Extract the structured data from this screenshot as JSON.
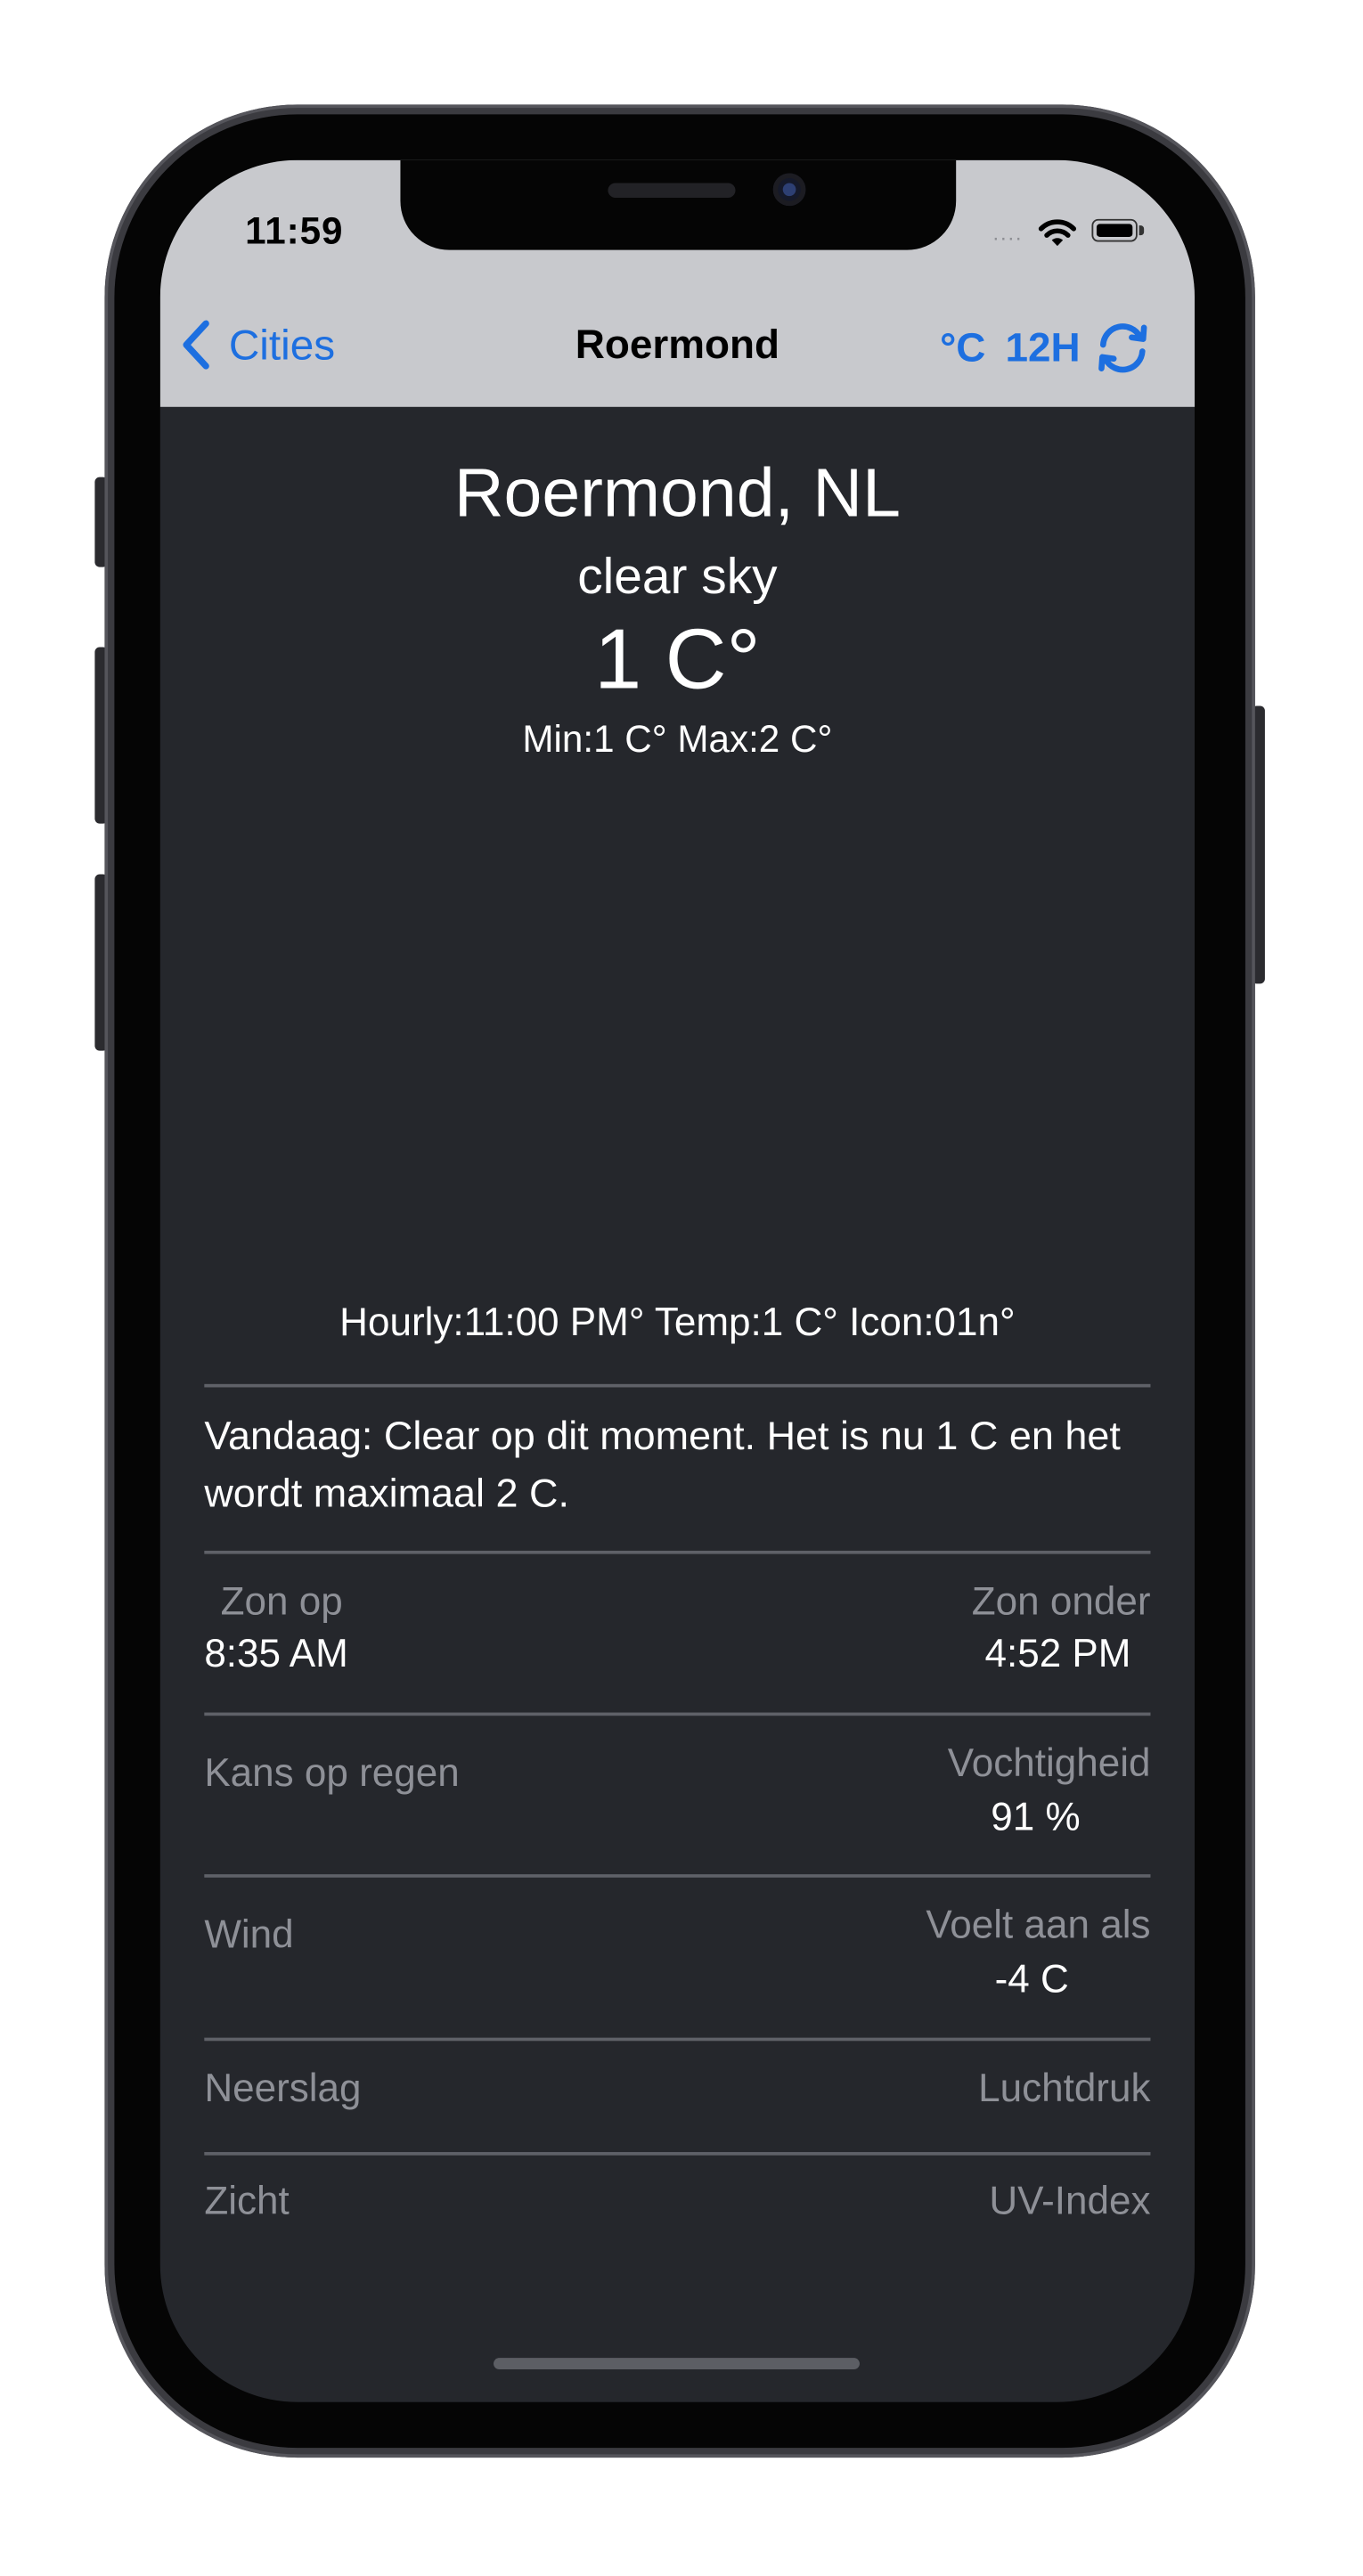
{
  "status_bar": {
    "time": "11:59",
    "signal": "....",
    "icons": [
      "wifi-icon",
      "battery-icon"
    ]
  },
  "nav": {
    "back_label": "Cities",
    "title": "Roermond",
    "unit_label": "°C",
    "format_label": "12H",
    "refresh_icon": "refresh-icon"
  },
  "weather": {
    "location": "Roermond, NL",
    "condition": "clear sky",
    "temperature": "1 C°",
    "min_max": "Min:1 C°  Max:2 C°",
    "hourly": "Hourly:11:00 PM°  Temp:1 C°  Icon:01n°",
    "summary": "Vandaag: Clear op dit moment. Het is nu 1 C en het wordt maximaal 2 C."
  },
  "details": {
    "sunrise_label": "Zon op",
    "sunrise_value": "8:35 AM",
    "sunset_label": "Zon onder",
    "sunset_value": "4:52 PM",
    "rain_chance_label": "Kans op regen",
    "humidity_label": "Vochtigheid",
    "humidity_value": "91 %",
    "wind_label": "Wind",
    "feels_like_label": "Voelt aan als",
    "feels_like_value": "-4 C",
    "precipitation_label": "Neerslag",
    "pressure_label": "Luchtdruk",
    "visibility_label": "Zicht",
    "uv_label": "UV-Index"
  },
  "colors": {
    "accent": "#1d6fe0",
    "nav_background": "#c8c9cd",
    "content_background": "#25272c",
    "label_gray": "#8e9097"
  }
}
